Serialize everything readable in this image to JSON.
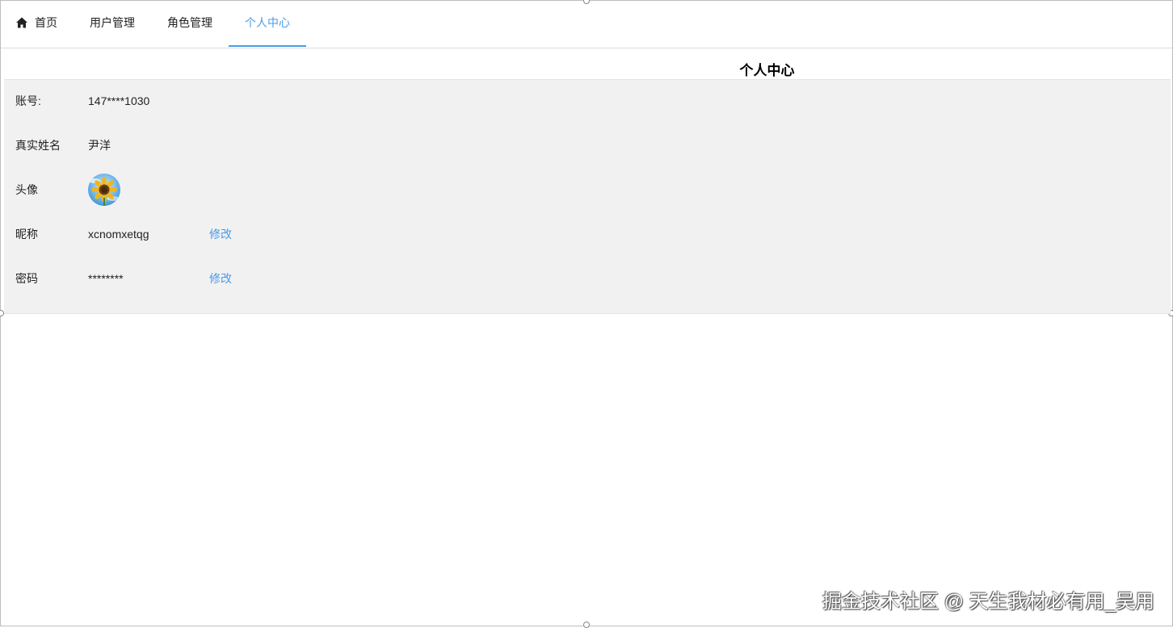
{
  "nav": {
    "tabs": [
      {
        "label": "首页",
        "icon": "home-icon"
      },
      {
        "label": "用户管理"
      },
      {
        "label": "角色管理"
      },
      {
        "label": "个人中心",
        "active": true
      }
    ]
  },
  "page": {
    "title": "个人中心"
  },
  "profile": {
    "account": {
      "label": "账号:",
      "value": "147****1030"
    },
    "real_name": {
      "label": "真实姓名",
      "value": "尹洋"
    },
    "avatar": {
      "label": "头像",
      "image": "sunflower-avatar"
    },
    "nickname": {
      "label": "昵称",
      "value": "xcnomxetqg",
      "edit_label": "修改"
    },
    "password": {
      "label": "密码",
      "value": "********",
      "edit_label": "修改"
    }
  },
  "watermark": "掘金技术社区 @ 天生我材必有用_吴用",
  "colors": {
    "accent": "#4a9be6",
    "panel_bg": "#f1f1f1"
  }
}
